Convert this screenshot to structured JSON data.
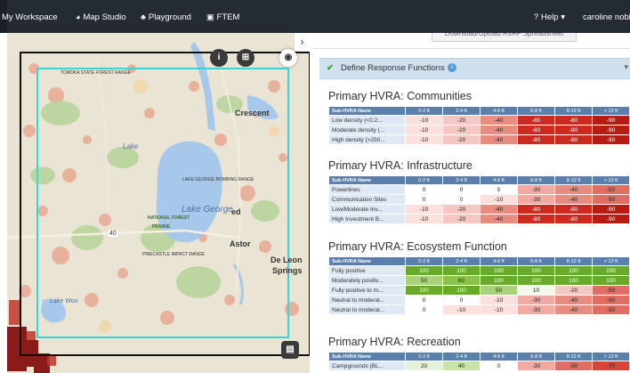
{
  "nav": {
    "items": [
      {
        "label": "My Workspace",
        "icon": "none"
      },
      {
        "label": "Map Studio",
        "icon": "globe-icon"
      },
      {
        "label": "Playground",
        "icon": "tree-icon"
      },
      {
        "label": "FTEM",
        "icon": "device-icon"
      }
    ],
    "help": "Help",
    "user": "caroline nobl"
  },
  "map": {
    "labels": {
      "crescent": "Crescent",
      "lake_george": "Lake George",
      "astor": "Astor",
      "de_leon": "De Leon",
      "springs": "Springs",
      "lake_woodruff": "Lake Woo",
      "highway_40": "40",
      "lake_george_range": "LAKE GEORGE BOMBING RANGE",
      "pinecastle": "PINECASTLE IMPACT RANGE",
      "range_top": "TOMOKA STATE FOREST RANGE",
      "nat_forest": "NATIONAL FOREST",
      "prairie": "PRAIRIE",
      "lake_label": "Lake",
      "ed": "ed"
    },
    "colors": {
      "background": "#e9e4d3",
      "lake": "#a7c8ea",
      "selection": "#35d6d6",
      "hazard_high": "#8b1a1a",
      "hazard_mid": "#e07a5f",
      "forest": "#b8d49c"
    }
  },
  "panel": {
    "download_label": "Download/Upload RxRF Spreadsheet",
    "accordion_title": "Define Response Functions",
    "header_cols": [
      "Sub-HVRA Name",
      "0-2 ft",
      "2-4 ft",
      "4-6 ft",
      "6-8 ft",
      "8-12 ft",
      "> 12 ft"
    ],
    "sections": [
      {
        "title": "Primary HVRA: Communities",
        "rows": [
          {
            "name": "Low density (<0.2...",
            "values": [
              -10,
              -20,
              -40,
              -80,
              -80,
              -90
            ]
          },
          {
            "name": "Moderate density (...",
            "values": [
              -10,
              -20,
              -40,
              -80,
              -80,
              -90
            ]
          },
          {
            "name": "High density (>250...",
            "values": [
              -10,
              -20,
              -40,
              -80,
              -80,
              -90
            ]
          }
        ]
      },
      {
        "title": "Primary HVRA: Infrastructure",
        "rows": [
          {
            "name": "Powerlines",
            "values": [
              0,
              0,
              0,
              -30,
              -40,
              -50
            ]
          },
          {
            "name": "Communication Sites",
            "values": [
              0,
              0,
              -10,
              -30,
              -40,
              -50
            ]
          },
          {
            "name": "Low/Moderate Inv...",
            "values": [
              -10,
              -20,
              -40,
              -80,
              -80,
              -90
            ]
          },
          {
            "name": "High Investment B...",
            "values": [
              -10,
              -20,
              -40,
              -80,
              -80,
              -90
            ]
          }
        ]
      },
      {
        "title": "Primary HVRA: Ecosystem Function",
        "rows": [
          {
            "name": "Fully positive",
            "values": [
              100,
              100,
              100,
              100,
              100,
              100
            ]
          },
          {
            "name": "Moderately positiv...",
            "values": [
              50,
              80,
              100,
              100,
              100,
              100
            ]
          },
          {
            "name": "Fully positive to m...",
            "values": [
              100,
              100,
              50,
              10,
              -20,
              -50
            ]
          },
          {
            "name": "Neutral to moderat...",
            "values": [
              0,
              0,
              -10,
              -30,
              -40,
              -50
            ]
          },
          {
            "name": "Neutral to moderat...",
            "values": [
              0,
              -10,
              -10,
              -30,
              -40,
              -50
            ]
          }
        ]
      },
      {
        "title": "Primary HVRA: Recreation",
        "rows": [
          {
            "name": "Campgrounds (BL...",
            "values": [
              20,
              40,
              0,
              -30,
              -50,
              -70
            ]
          }
        ]
      }
    ]
  }
}
